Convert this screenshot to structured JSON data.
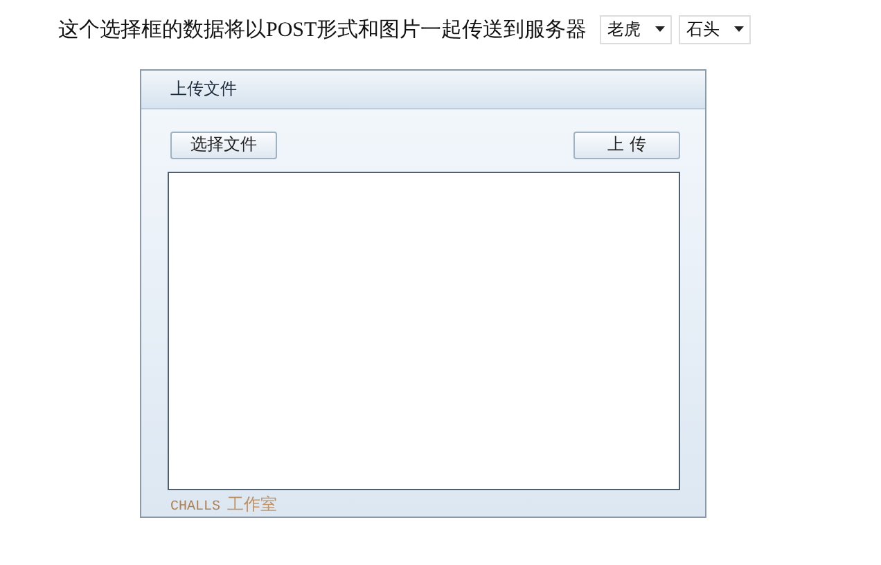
{
  "intro": {
    "text": "这个选择框的数据将以POST形式和图片一起传送到服务器"
  },
  "selects": [
    {
      "value": "老虎"
    },
    {
      "value": "石头"
    }
  ],
  "panel": {
    "title": "上传文件",
    "choose_button": "选择文件",
    "upload_button": "上 传",
    "footer": {
      "brand": "CHALLS",
      "studio": "工作室"
    }
  }
}
